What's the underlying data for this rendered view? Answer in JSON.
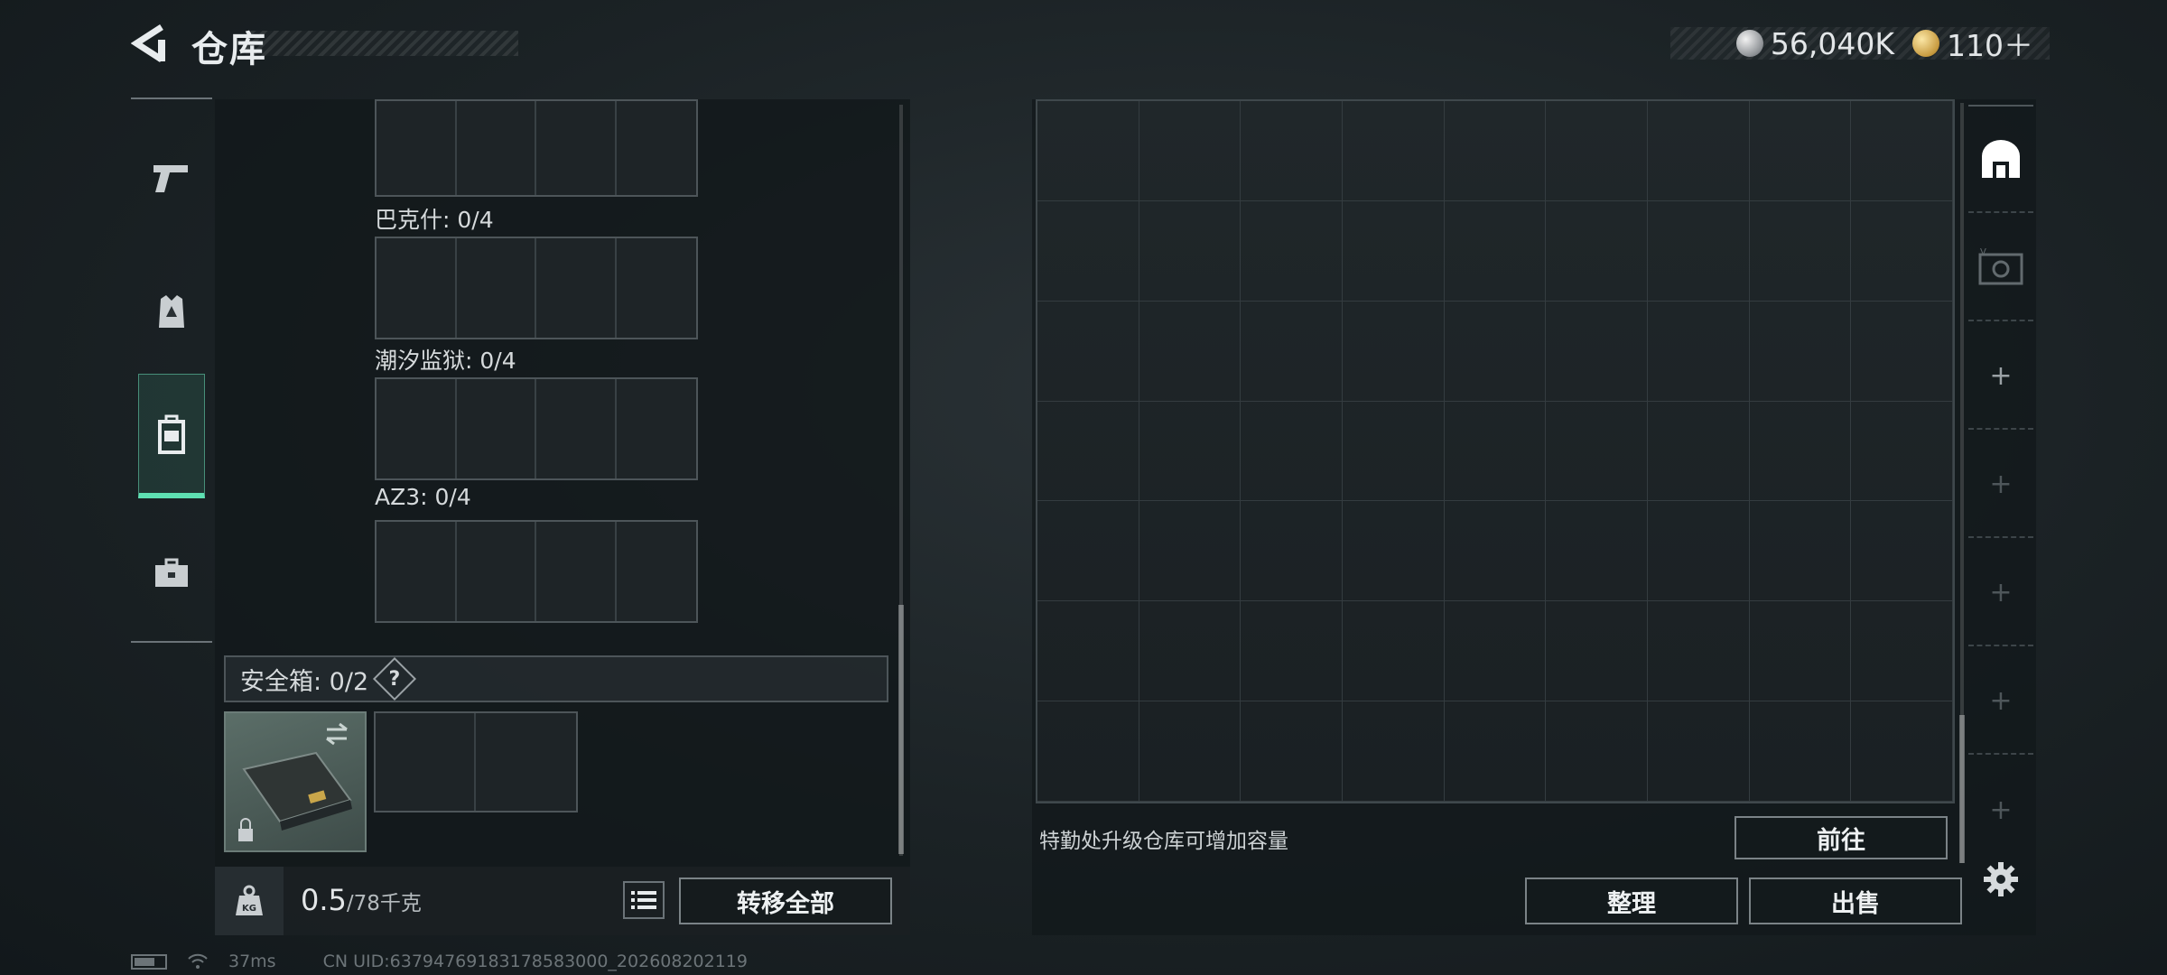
{
  "header": {
    "title": "仓库",
    "currency": [
      {
        "icon": "silver-coin-icon",
        "value": "56,040K"
      },
      {
        "icon": "gold-medal-icon",
        "value": "110＋"
      }
    ]
  },
  "tabs": [
    {
      "icon": "pistol-icon",
      "active": false
    },
    {
      "icon": "armor-vest-icon",
      "active": false
    },
    {
      "icon": "backpack-icon",
      "active": true
    },
    {
      "icon": "toolbox-icon",
      "active": false
    }
  ],
  "loadout": {
    "sections": [
      {
        "label": "巴克什: 0/4"
      },
      {
        "label": "潮汐监狱: 0/4"
      },
      {
        "label": "AZ3: 0/4"
      }
    ],
    "safe_box": {
      "label": "安全箱:  0/2",
      "help": "?"
    },
    "weight_value": "0.5",
    "weight_max": "/78千克",
    "transfer_all": "转移全部"
  },
  "storage": {
    "hint": "特勤处升级仓库可增加容量",
    "goto": "前往",
    "tidy": "整理",
    "sell": "出售"
  },
  "status": {
    "ping": "37ms",
    "uid": "CN UID:63794769183178583000_202608202119"
  }
}
